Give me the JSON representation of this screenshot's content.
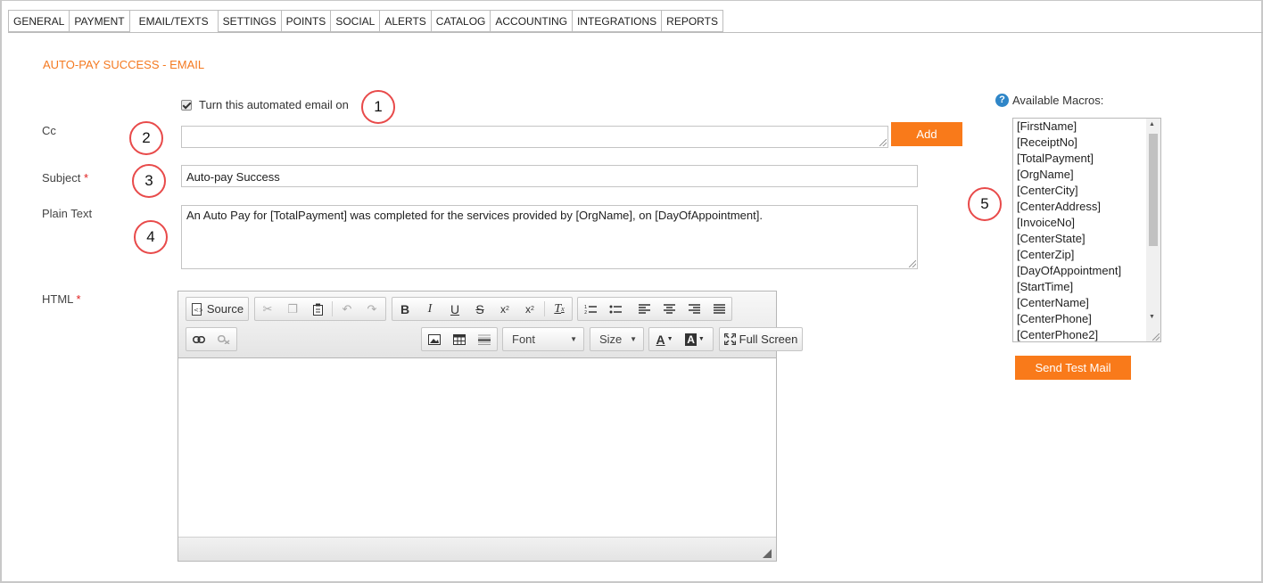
{
  "tabs": [
    {
      "label": "GENERAL"
    },
    {
      "label": "PAYMENT"
    },
    {
      "label": "EMAIL/TEXTS"
    },
    {
      "label": "SETTINGS"
    },
    {
      "label": "POINTS"
    },
    {
      "label": "SOCIAL"
    },
    {
      "label": "ALERTS"
    },
    {
      "label": "CATALOG"
    },
    {
      "label": "ACCOUNTING"
    },
    {
      "label": "INTEGRATIONS"
    },
    {
      "label": "REPORTS"
    }
  ],
  "active_tab": "EMAIL/TEXTS",
  "section_title": "AUTO-PAY SUCCESS - EMAIL",
  "form": {
    "toggle_label": "Turn this automated email on",
    "toggle_checked": true,
    "cc_label": "Cc",
    "cc_value": "",
    "add_button": "Add",
    "subject_label": "Subject",
    "subject_value": "Auto-pay Success",
    "plain_text_label": "Plain Text",
    "plain_text_value": "An Auto Pay for [TotalPayment] was completed for the services provided by [OrgName], on [DayOfAppointment].",
    "html_label": "HTML",
    "required_mark": "*"
  },
  "editor": {
    "source_label": "Source",
    "font_label": "Font",
    "size_label": "Size",
    "fullscreen_label": "Full Screen",
    "body": ""
  },
  "macros": {
    "heading": "Available Macros:",
    "help_icon": "?",
    "items": [
      "[FirstName]",
      "[ReceiptNo]",
      "[TotalPayment]",
      "[OrgName]",
      "[CenterCity]",
      "[CenterAddress]",
      "[InvoiceNo]",
      "[CenterState]",
      "[CenterZip]",
      "[DayOfAppointment]",
      "[StartTime]",
      "[CenterName]",
      "[CenterPhone]",
      "[CenterPhone2]"
    ],
    "send_test_button": "Send Test Mail"
  },
  "callouts": [
    "1",
    "2",
    "3",
    "4",
    "5"
  ],
  "colors": {
    "accent": "#f47920",
    "button": "#f97a1a",
    "callout_border": "#e84a4a",
    "required": "#e02020",
    "help": "#2f86c8"
  }
}
